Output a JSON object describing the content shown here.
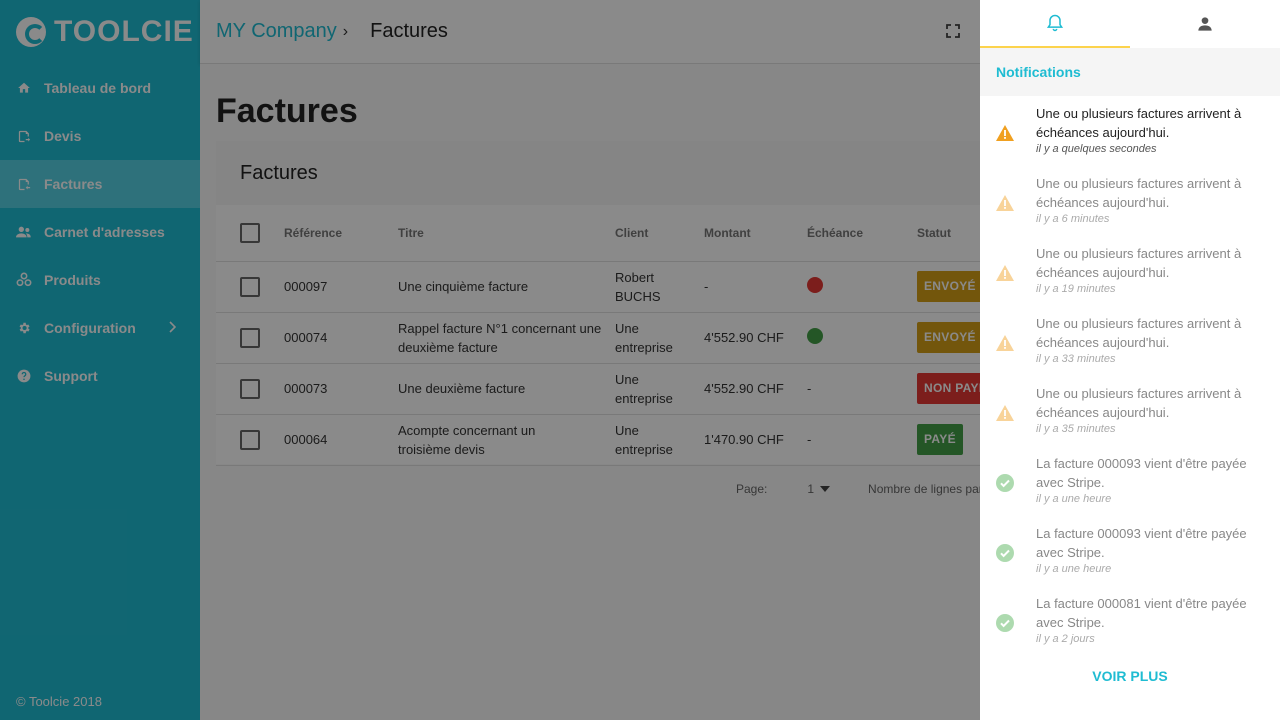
{
  "brand": {
    "name": "TOOLCIE"
  },
  "sidebar": {
    "items": [
      {
        "label": "Tableau de bord",
        "icon": "home-icon"
      },
      {
        "label": "Devis",
        "icon": "quote-icon"
      },
      {
        "label": "Factures",
        "icon": "invoice-icon",
        "active": true
      },
      {
        "label": "Carnet d'adresses",
        "icon": "contacts-icon"
      },
      {
        "label": "Produits",
        "icon": "products-icon"
      },
      {
        "label": "Configuration",
        "icon": "gear-icon"
      },
      {
        "label": "Support",
        "icon": "help-icon"
      }
    ],
    "copyright": "© Toolcie 2018"
  },
  "header": {
    "company": "MY Company",
    "separator": "›",
    "page": "Factures"
  },
  "main": {
    "title": "Factures",
    "card_title": "Factures",
    "columns": [
      "Référence",
      "Titre",
      "Client",
      "Montant",
      "Échéance",
      "Statut"
    ],
    "rows": [
      {
        "ref": "000097",
        "title": "Une cinquième facture",
        "client": "Robert BUCHS",
        "amount": "-",
        "due": "",
        "status": "ENVOYÉ"
      },
      {
        "ref": "000074",
        "title": "Rappel facture N°1 concernant une deuxième facture",
        "client": "Une entreprise",
        "amount": "4'552.90 CHF",
        "due": "",
        "status": "ENVOYÉ"
      },
      {
        "ref": "000073",
        "title": "Une deuxième facture",
        "client": "Une entreprise",
        "amount": "4'552.90 CHF",
        "due": "-",
        "status": "NON PAYÉ"
      },
      {
        "ref": "000064",
        "title": "Acompte concernant un troisième devis",
        "client": "Une entreprise",
        "amount": "1'470.90 CHF",
        "due": "-",
        "status": "PAYÉ"
      }
    ],
    "pager": {
      "page_label": "Page:",
      "page": "1",
      "rows_label": "Nombre de lignes par p"
    }
  },
  "colors": {
    "brand": "#1fbcd2",
    "sent": "#d4a017",
    "unpaid": "#e53935",
    "paid": "#43a047",
    "warn": "#f0a020",
    "ok": "#5cc25e"
  },
  "notifications": {
    "title": "Notifications",
    "items": [
      {
        "text": "Une ou plusieurs factures arrivent à échéances aujourd'hui.",
        "time": "il y a quelques secondes",
        "type": "warning",
        "read": false
      },
      {
        "text": "Une ou plusieurs factures arrivent à échéances aujourd'hui.",
        "time": "il y a 6 minutes",
        "type": "warning",
        "read": true
      },
      {
        "text": "Une ou plusieurs factures arrivent à échéances aujourd'hui.",
        "time": "il y a 19 minutes",
        "type": "warning",
        "read": true
      },
      {
        "text": "Une ou plusieurs factures arrivent à échéances aujourd'hui.",
        "time": "il y a 33 minutes",
        "type": "warning",
        "read": true
      },
      {
        "text": "Une ou plusieurs factures arrivent à échéances aujourd'hui.",
        "time": "il y a 35 minutes",
        "type": "warning",
        "read": true
      },
      {
        "text": "La facture 000093 vient d'être payée avec Stripe.",
        "time": "il y a une heure",
        "type": "success",
        "read": true
      },
      {
        "text": "La facture 000093 vient d'être payée avec Stripe.",
        "time": "il y a une heure",
        "type": "success",
        "read": true
      },
      {
        "text": "La facture 000081 vient d'être payée avec Stripe.",
        "time": "il y a 2 jours",
        "type": "success",
        "read": true
      }
    ],
    "more_label": "VOIR PLUS"
  }
}
